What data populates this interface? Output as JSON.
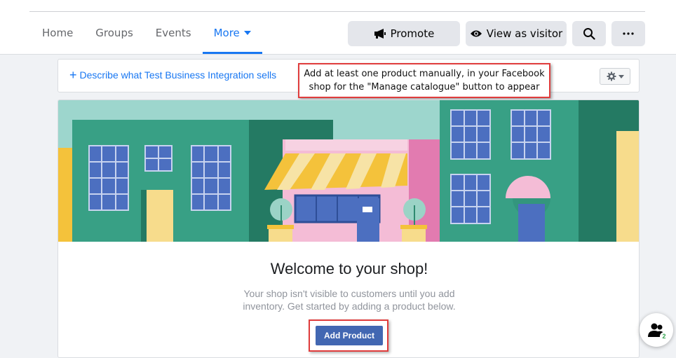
{
  "nav": {
    "tabs": [
      {
        "label": "Home"
      },
      {
        "label": "Groups"
      },
      {
        "label": "Events"
      },
      {
        "label": "More"
      }
    ],
    "actions": {
      "promote": "Promote",
      "view_as_visitor": "View as visitor"
    }
  },
  "describe_bar": {
    "link": "Describe what Test Business Integration sells"
  },
  "callout": {
    "line1": "Add at least one product manually, in your Facebook",
    "line2": "shop for the \"Manage catalogue\" button to appear"
  },
  "shop": {
    "title": "Welcome to your shop!",
    "subtext": "Your shop isn't visible to customers until you add inventory. Get started by adding a product below.",
    "add_button": "Add Product"
  },
  "chat": {
    "badge_count": "2"
  },
  "colors": {
    "accent": "#1877f2",
    "button_primary": "#4267b2",
    "highlight_red": "#e03c3c"
  },
  "icons": {
    "promote": "megaphone-icon",
    "visitor": "eye-icon",
    "search": "search-icon",
    "more": "more-dots-icon",
    "settings": "gear-icon",
    "chat": "people-icon"
  }
}
